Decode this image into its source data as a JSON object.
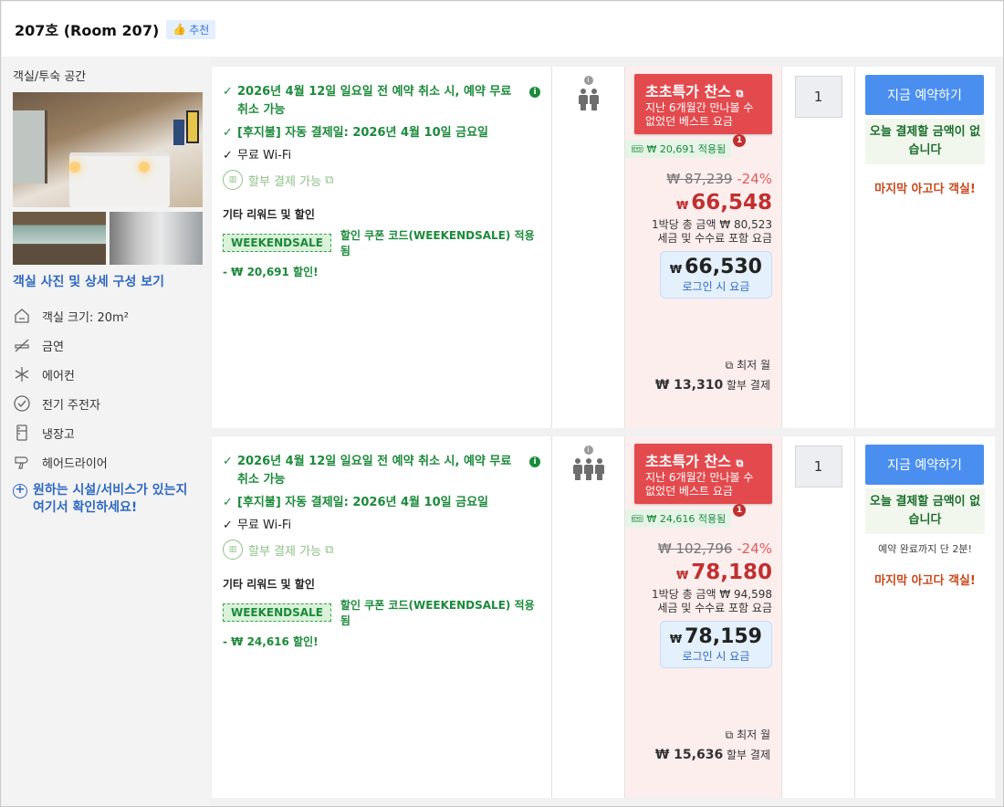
{
  "header": {
    "room_title": "207호 (Room 207)",
    "rec_label": "추천"
  },
  "left": {
    "section": "객실/투숙 공간",
    "view_photos": "객실 사진 및 상세 구성 보기",
    "amenities": [
      {
        "icon": "room-size-icon",
        "label": "객실 크기: 20m²"
      },
      {
        "icon": "no-smoking-icon",
        "label": "금연"
      },
      {
        "icon": "snowflake-icon",
        "label": "에어컨"
      },
      {
        "icon": "kettle-icon",
        "label": "전기 주전자"
      },
      {
        "icon": "fridge-icon",
        "label": "냉장고"
      },
      {
        "icon": "hairdryer-icon",
        "label": "헤어드라이어"
      }
    ],
    "facility_link": "원하는 시설/서비스가 있는지 여기서 확인하세요!"
  },
  "rows": [
    {
      "benefits": {
        "cancel": "2026년 4월 12일 일요일 전 예약 취소 시, 예약 무료 취소 가능",
        "autopay": "[후지불] 자동 결제일: 2026년 4월 10일 금요일",
        "wifi": "무료 Wi-Fi",
        "installment": "할부 결제 가능"
      },
      "rewards_title": "기타 리워드 및 할인",
      "coupon": "WEEKENDSALE",
      "coupon_text": "할인 쿠폰 코드(WEEKENDSALE) 적용됨",
      "discount": "- ₩ 20,691 할인!",
      "occupancy": 2,
      "deal_title": "초초특가 찬스",
      "deal_sub": "지난 6개월간 만나볼 수 없었던 베스트 요금",
      "applied": "₩ 20,691 적용됨",
      "applied_badge": "1",
      "orig_price": "₩ 87,239",
      "pct": "-24%",
      "currency": "₩",
      "price": "66,548",
      "per_night": "1박당 총 금액 ₩ 80,523",
      "tax_note": "세금 및 수수료 포함 요금",
      "login_price": "66,530",
      "login_label": "로그인 시 요금",
      "monthly_label": "최저 월",
      "monthly_amount": "₩ 13,310",
      "monthly_suffix": "할부 결제",
      "qty": "1",
      "book_label": "지금 예약하기",
      "pay_note": "오늘 결제할 금액이 없습니다",
      "time_note": "",
      "last_room": "마지막 아고다 객실!"
    },
    {
      "benefits": {
        "cancel": "2026년 4월 12일 일요일 전 예약 취소 시, 예약 무료 취소 가능",
        "autopay": "[후지불] 자동 결제일: 2026년 4월 10일 금요일",
        "wifi": "무료 Wi-Fi",
        "installment": "할부 결제 가능"
      },
      "rewards_title": "기타 리워드 및 할인",
      "coupon": "WEEKENDSALE",
      "coupon_text": "할인 쿠폰 코드(WEEKENDSALE) 적용됨",
      "discount": "- ₩ 24,616 할인!",
      "occupancy": 3,
      "deal_title": "초초특가 찬스",
      "deal_sub": "지난 6개월간 만나볼 수 없었던 베스트 요금",
      "applied": "₩ 24,616 적용됨",
      "applied_badge": "1",
      "orig_price": "₩ 102,796",
      "pct": "-24%",
      "currency": "₩",
      "price": "78,180",
      "per_night": "1박당 총 금액 ₩ 94,598",
      "tax_note": "세금 및 수수료 포함 요금",
      "login_price": "78,159",
      "login_label": "로그인 시 요금",
      "monthly_label": "최저 월",
      "monthly_amount": "₩ 15,636",
      "monthly_suffix": "할부 결제",
      "qty": "1",
      "book_label": "지금 예약하기",
      "pay_note": "오늘 결제할 금액이 없습니다",
      "time_note": "예약 완료까지 단 2분!",
      "last_room": "마지막 아고다 객실!"
    }
  ],
  "colors": {
    "green": "#1b8a3a",
    "deal_red": "#e24a4e",
    "price_red": "#c0302f",
    "link_blue": "#2e69c2",
    "book_blue": "#4a8ff0"
  }
}
